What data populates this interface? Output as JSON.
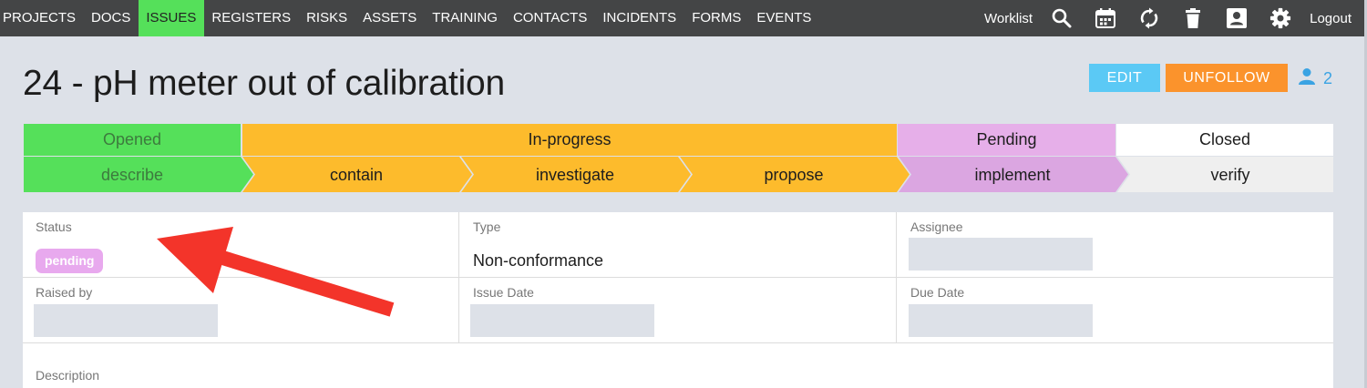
{
  "nav": {
    "items": [
      "PROJECTS",
      "DOCS",
      "ISSUES",
      "REGISTERS",
      "RISKS",
      "ASSETS",
      "TRAINING",
      "CONTACTS",
      "INCIDENTS",
      "FORMS",
      "EVENTS"
    ],
    "active": "ISSUES",
    "worklist": "Worklist",
    "logout": "Logout",
    "icons": [
      "search-icon",
      "calendar-icon",
      "sync-icon",
      "trash-icon",
      "account-icon",
      "gear-icon"
    ]
  },
  "issue": {
    "title": "24 - pH meter out of calibration",
    "edit_label": "EDIT",
    "unfollow_label": "UNFOLLOW",
    "followers_count": "2"
  },
  "workflow": {
    "phases": [
      "Opened",
      "In-progress",
      "Pending",
      "Closed"
    ],
    "steps": [
      "describe",
      "contain",
      "investigate",
      "propose",
      "implement",
      "verify"
    ],
    "colors": {
      "opened": "#55e05a",
      "in_progress": "#fdbb2c",
      "pending": "#e6afe9",
      "closed": "#ffffff",
      "step_pending": "#dba6e1",
      "step_open": "#efefef"
    }
  },
  "details": {
    "status_label": "Status",
    "status_value": "pending",
    "type_label": "Type",
    "type_value": "Non-conformance",
    "assignee_label": "Assignee",
    "raised_by_label": "Raised by",
    "issue_date_label": "Issue Date",
    "due_date_label": "Due Date",
    "description_label": "Description"
  }
}
